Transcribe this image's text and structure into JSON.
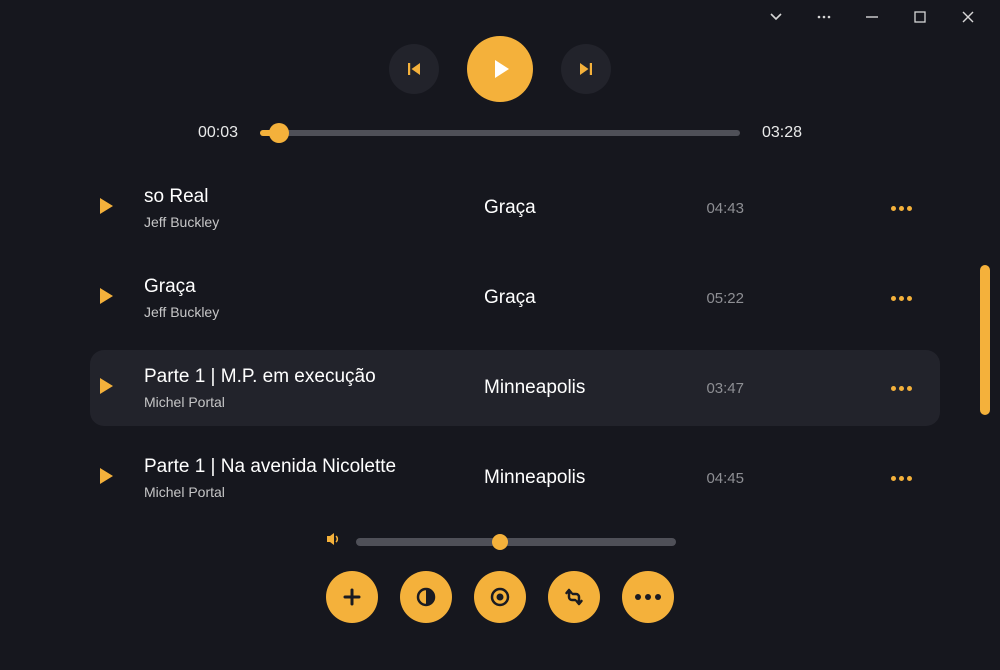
{
  "seek": {
    "current": "00:03",
    "total": "03:28"
  },
  "tracks": [
    {
      "title": "so Real",
      "artist": "Jeff Buckley",
      "album": "Graça",
      "duration": "04:43"
    },
    {
      "title": "Graça",
      "artist": "Jeff Buckley",
      "album": "Graça",
      "duration": "05:22"
    },
    {
      "title": "Parte 1 | M.P. em execução",
      "artist": "Michel  Portal",
      "album": "Minneapolis",
      "duration": "03:47"
    },
    {
      "title": "Parte 1 | Na avenida Nicolette",
      "artist": "Michel Portal",
      "album": "Minneapolis",
      "duration": "04:45"
    }
  ],
  "highlight_index": 2
}
